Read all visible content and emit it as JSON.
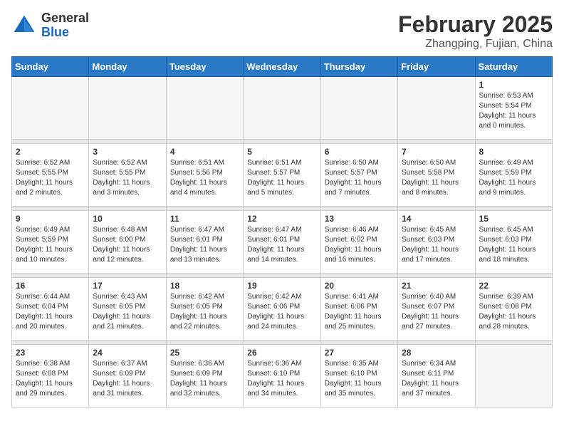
{
  "header": {
    "logo_general": "General",
    "logo_blue": "Blue",
    "month_title": "February 2025",
    "subtitle": "Zhangping, Fujian, China"
  },
  "days_of_week": [
    "Sunday",
    "Monday",
    "Tuesday",
    "Wednesday",
    "Thursday",
    "Friday",
    "Saturday"
  ],
  "weeks": [
    [
      {
        "day": "",
        "info": ""
      },
      {
        "day": "",
        "info": ""
      },
      {
        "day": "",
        "info": ""
      },
      {
        "day": "",
        "info": ""
      },
      {
        "day": "",
        "info": ""
      },
      {
        "day": "",
        "info": ""
      },
      {
        "day": "1",
        "info": "Sunrise: 6:53 AM\nSunset: 5:54 PM\nDaylight: 11 hours and 0 minutes."
      }
    ],
    [
      {
        "day": "2",
        "info": "Sunrise: 6:52 AM\nSunset: 5:55 PM\nDaylight: 11 hours and 2 minutes."
      },
      {
        "day": "3",
        "info": "Sunrise: 6:52 AM\nSunset: 5:55 PM\nDaylight: 11 hours and 3 minutes."
      },
      {
        "day": "4",
        "info": "Sunrise: 6:51 AM\nSunset: 5:56 PM\nDaylight: 11 hours and 4 minutes."
      },
      {
        "day": "5",
        "info": "Sunrise: 6:51 AM\nSunset: 5:57 PM\nDaylight: 11 hours and 5 minutes."
      },
      {
        "day": "6",
        "info": "Sunrise: 6:50 AM\nSunset: 5:57 PM\nDaylight: 11 hours and 7 minutes."
      },
      {
        "day": "7",
        "info": "Sunrise: 6:50 AM\nSunset: 5:58 PM\nDaylight: 11 hours and 8 minutes."
      },
      {
        "day": "8",
        "info": "Sunrise: 6:49 AM\nSunset: 5:59 PM\nDaylight: 11 hours and 9 minutes."
      }
    ],
    [
      {
        "day": "9",
        "info": "Sunrise: 6:49 AM\nSunset: 5:59 PM\nDaylight: 11 hours and 10 minutes."
      },
      {
        "day": "10",
        "info": "Sunrise: 6:48 AM\nSunset: 6:00 PM\nDaylight: 11 hours and 12 minutes."
      },
      {
        "day": "11",
        "info": "Sunrise: 6:47 AM\nSunset: 6:01 PM\nDaylight: 11 hours and 13 minutes."
      },
      {
        "day": "12",
        "info": "Sunrise: 6:47 AM\nSunset: 6:01 PM\nDaylight: 11 hours and 14 minutes."
      },
      {
        "day": "13",
        "info": "Sunrise: 6:46 AM\nSunset: 6:02 PM\nDaylight: 11 hours and 16 minutes."
      },
      {
        "day": "14",
        "info": "Sunrise: 6:45 AM\nSunset: 6:03 PM\nDaylight: 11 hours and 17 minutes."
      },
      {
        "day": "15",
        "info": "Sunrise: 6:45 AM\nSunset: 6:03 PM\nDaylight: 11 hours and 18 minutes."
      }
    ],
    [
      {
        "day": "16",
        "info": "Sunrise: 6:44 AM\nSunset: 6:04 PM\nDaylight: 11 hours and 20 minutes."
      },
      {
        "day": "17",
        "info": "Sunrise: 6:43 AM\nSunset: 6:05 PM\nDaylight: 11 hours and 21 minutes."
      },
      {
        "day": "18",
        "info": "Sunrise: 6:42 AM\nSunset: 6:05 PM\nDaylight: 11 hours and 22 minutes."
      },
      {
        "day": "19",
        "info": "Sunrise: 6:42 AM\nSunset: 6:06 PM\nDaylight: 11 hours and 24 minutes."
      },
      {
        "day": "20",
        "info": "Sunrise: 6:41 AM\nSunset: 6:06 PM\nDaylight: 11 hours and 25 minutes."
      },
      {
        "day": "21",
        "info": "Sunrise: 6:40 AM\nSunset: 6:07 PM\nDaylight: 11 hours and 27 minutes."
      },
      {
        "day": "22",
        "info": "Sunrise: 6:39 AM\nSunset: 6:08 PM\nDaylight: 11 hours and 28 minutes."
      }
    ],
    [
      {
        "day": "23",
        "info": "Sunrise: 6:38 AM\nSunset: 6:08 PM\nDaylight: 11 hours and 29 minutes."
      },
      {
        "day": "24",
        "info": "Sunrise: 6:37 AM\nSunset: 6:09 PM\nDaylight: 11 hours and 31 minutes."
      },
      {
        "day": "25",
        "info": "Sunrise: 6:36 AM\nSunset: 6:09 PM\nDaylight: 11 hours and 32 minutes."
      },
      {
        "day": "26",
        "info": "Sunrise: 6:36 AM\nSunset: 6:10 PM\nDaylight: 11 hours and 34 minutes."
      },
      {
        "day": "27",
        "info": "Sunrise: 6:35 AM\nSunset: 6:10 PM\nDaylight: 11 hours and 35 minutes."
      },
      {
        "day": "28",
        "info": "Sunrise: 6:34 AM\nSunset: 6:11 PM\nDaylight: 11 hours and 37 minutes."
      },
      {
        "day": "",
        "info": ""
      }
    ]
  ]
}
